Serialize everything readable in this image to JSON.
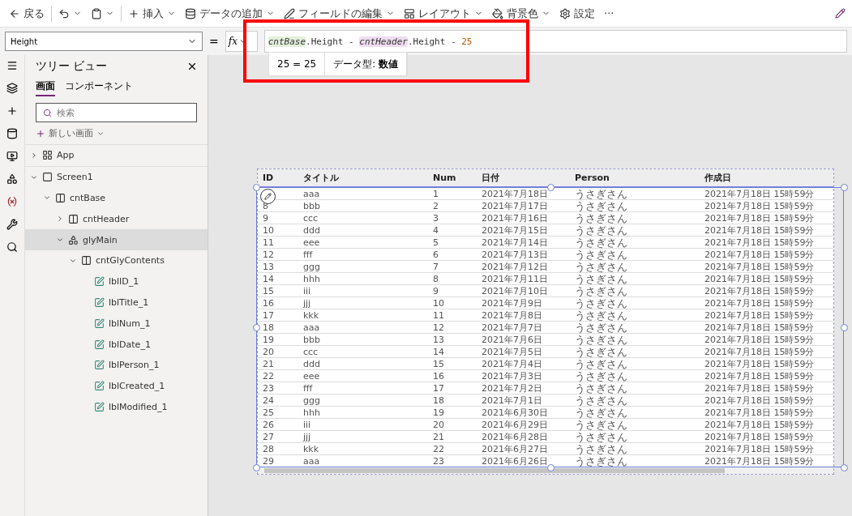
{
  "toolbar": {
    "items": [
      {
        "kind": "back",
        "label": "戻る"
      },
      {
        "kind": "undo"
      },
      {
        "kind": "paste"
      },
      {
        "kind": "insert",
        "label": "挿入"
      },
      {
        "kind": "data",
        "label": "データの追加"
      },
      {
        "kind": "fields",
        "label": "フィールドの編集"
      },
      {
        "kind": "layout",
        "label": "レイアウト"
      },
      {
        "kind": "background",
        "label": "背景色"
      },
      {
        "kind": "settings",
        "label": "設定"
      },
      {
        "kind": "more",
        "label": "···"
      }
    ]
  },
  "formula_bar": {
    "property": "Height",
    "equals": "=",
    "fx": "fx",
    "tokens": [
      {
        "kind": "ref",
        "text": "cntBase",
        "color": "#e3f0dc"
      },
      {
        "kind": "text",
        "text": ".Height - "
      },
      {
        "kind": "ref",
        "text": "cntHeader",
        "color": "#eedcf0"
      },
      {
        "kind": "text",
        "text": ".Height - "
      },
      {
        "kind": "number",
        "text": "25"
      }
    ],
    "result": "25 = 25",
    "datatype": "データ型: **数値**"
  },
  "tree": {
    "title": "ツリー ビュー",
    "tabs": [
      {
        "label": "画面",
        "selected": true
      },
      {
        "label": "コンポーネント",
        "selected": false
      }
    ],
    "search": {
      "placeholder": "検索"
    },
    "new_screen": "新しい画面",
    "items": [
      {
        "kind": "app",
        "label": "App",
        "expanded": false
      },
      {
        "kind": "screen",
        "label": "Screen1",
        "expanded": true,
        "children": [
          {
            "kind": "container",
            "label": "cntBase",
            "expanded": true,
            "children": [
              {
                "kind": "container",
                "label": "cntHeader",
                "expanded": false
              },
              {
                "kind": "gallery",
                "label": "glyMain",
                "expanded": true,
                "selected": true,
                "children": [
                  {
                    "kind": "container",
                    "label": "cntGlyContents",
                    "expanded": true,
                    "children": [
                      {
                        "kind": "label",
                        "label": "lblID_1"
                      },
                      {
                        "kind": "label",
                        "label": "lblTitle_1"
                      },
                      {
                        "kind": "label",
                        "label": "lblNum_1"
                      },
                      {
                        "kind": "label",
                        "label": "lblDate_1"
                      },
                      {
                        "kind": "label",
                        "label": "lblPerson_1"
                      },
                      {
                        "kind": "label",
                        "label": "lblCreated_1"
                      },
                      {
                        "kind": "label",
                        "label": "lblModified_1"
                      }
                    ]
                  }
                ]
              }
            ]
          }
        ]
      }
    ]
  },
  "gallery": {
    "columns": [
      "ID",
      "タイトル",
      "Num",
      "日付",
      "Person",
      "作成日"
    ],
    "rows": [
      [
        "",
        "aaa",
        "1",
        "2021年7月18日",
        "うさぎさん",
        "2021年7月18日 15時59分"
      ],
      [
        "8",
        "bbb",
        "2",
        "2021年7月17日",
        "うさぎさん",
        "2021年7月18日 15時59分"
      ],
      [
        "9",
        "ccc",
        "3",
        "2021年7月16日",
        "うさぎさん",
        "2021年7月18日 15時59分"
      ],
      [
        "10",
        "ddd",
        "4",
        "2021年7月15日",
        "うさぎさん",
        "2021年7月18日 15時59分"
      ],
      [
        "11",
        "eee",
        "5",
        "2021年7月14日",
        "うさぎさん",
        "2021年7月18日 15時59分"
      ],
      [
        "12",
        "fff",
        "6",
        "2021年7月13日",
        "うさぎさん",
        "2021年7月18日 15時59分"
      ],
      [
        "13",
        "ggg",
        "7",
        "2021年7月12日",
        "うさぎさん",
        "2021年7月18日 15時59分"
      ],
      [
        "14",
        "hhh",
        "8",
        "2021年7月11日",
        "うさぎさん",
        "2021年7月18日 15時59分"
      ],
      [
        "15",
        "iii",
        "9",
        "2021年7月10日",
        "うさぎさん",
        "2021年7月18日 15時59分"
      ],
      [
        "16",
        "jjj",
        "10",
        "2021年7月9日",
        "うさぎさん",
        "2021年7月18日 15時59分"
      ],
      [
        "17",
        "kkk",
        "11",
        "2021年7月8日",
        "うさぎさん",
        "2021年7月18日 15時59分"
      ],
      [
        "18",
        "aaa",
        "12",
        "2021年7月7日",
        "うさぎさん",
        "2021年7月18日 15時59分"
      ],
      [
        "19",
        "bbb",
        "13",
        "2021年7月6日",
        "うさぎさん",
        "2021年7月18日 15時59分"
      ],
      [
        "20",
        "ccc",
        "14",
        "2021年7月5日",
        "うさぎさん",
        "2021年7月18日 15時59分"
      ],
      [
        "21",
        "ddd",
        "15",
        "2021年7月4日",
        "うさぎさん",
        "2021年7月18日 15時59分"
      ],
      [
        "22",
        "eee",
        "16",
        "2021年7月3日",
        "うさぎさん",
        "2021年7月18日 15時59分"
      ],
      [
        "23",
        "fff",
        "17",
        "2021年7月2日",
        "うさぎさん",
        "2021年7月18日 15時59分"
      ],
      [
        "24",
        "ggg",
        "18",
        "2021年7月1日",
        "うさぎさん",
        "2021年7月18日 15時59分"
      ],
      [
        "25",
        "hhh",
        "19",
        "2021年6月30日",
        "うさぎさん",
        "2021年7月18日 15時59分"
      ],
      [
        "26",
        "iii",
        "20",
        "2021年6月29日",
        "うさぎさん",
        "2021年7月18日 15時59分"
      ],
      [
        "27",
        "jjj",
        "21",
        "2021年6月28日",
        "うさぎさん",
        "2021年7月18日 15時59分"
      ],
      [
        "28",
        "kkk",
        "22",
        "2021年6月27日",
        "うさぎさん",
        "2021年7月18日 15時59分"
      ],
      [
        "29",
        "aaa",
        "23",
        "2021年6月26日",
        "うさぎさん",
        "2021年7月18日 15時59分"
      ]
    ]
  }
}
